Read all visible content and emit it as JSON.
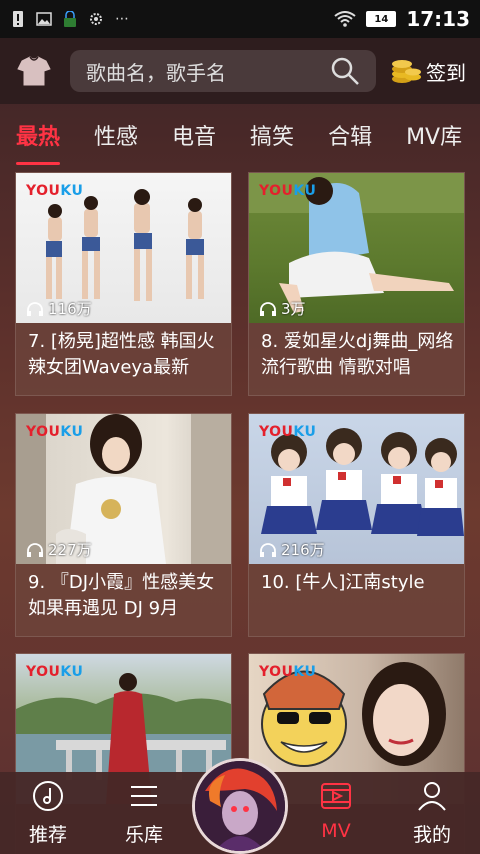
{
  "status_bar": {
    "battery": "14",
    "time": "17:13",
    "icons": [
      "alert-icon",
      "image-icon",
      "lock-icon",
      "gear-icon",
      "more-icon",
      "wifi-icon"
    ]
  },
  "header": {
    "search_placeholder": "歌曲名，歌手名",
    "checkin_label": "签到"
  },
  "tabs": [
    {
      "label": "最热",
      "active": true
    },
    {
      "label": "性感",
      "active": false
    },
    {
      "label": "电音",
      "active": false
    },
    {
      "label": "搞笑",
      "active": false
    },
    {
      "label": "合辑",
      "active": false
    },
    {
      "label": "MV库",
      "active": false
    }
  ],
  "videos": [
    {
      "title": "7. [杨晃]超性感 韩国火辣女团Waveya最新",
      "plays": "116万",
      "brand_a": "YOU",
      "brand_b": "KU"
    },
    {
      "title": "8. 爱如星火dj舞曲_网络流行歌曲 情歌对唱",
      "plays": "3万",
      "brand_a": "YOU",
      "brand_b": "KU"
    },
    {
      "title": "9. 『DJ小霞』性感美女 如果再遇见 DJ 9月",
      "plays": "227万",
      "brand_a": "YOU",
      "brand_b": "KU"
    },
    {
      "title": "10. [牛人]江南style",
      "plays": "216万",
      "brand_a": "YOU",
      "brand_b": "KU"
    },
    {
      "title": "",
      "plays": "",
      "brand_a": "YOU",
      "brand_b": "KU"
    },
    {
      "title": "",
      "plays": "",
      "brand_a": "YOU",
      "brand_b": "KU"
    }
  ],
  "bottom_nav": [
    {
      "label": "推荐",
      "icon": "music-disc-icon"
    },
    {
      "label": "乐库",
      "icon": "list-icon"
    },
    {
      "label": "MV",
      "icon": "video-icon",
      "active": true
    },
    {
      "label": "我的",
      "icon": "user-icon"
    }
  ],
  "colors": {
    "accent": "#ff3344",
    "youku_red": "#e4202c",
    "youku_blue": "#1a9ee8"
  }
}
